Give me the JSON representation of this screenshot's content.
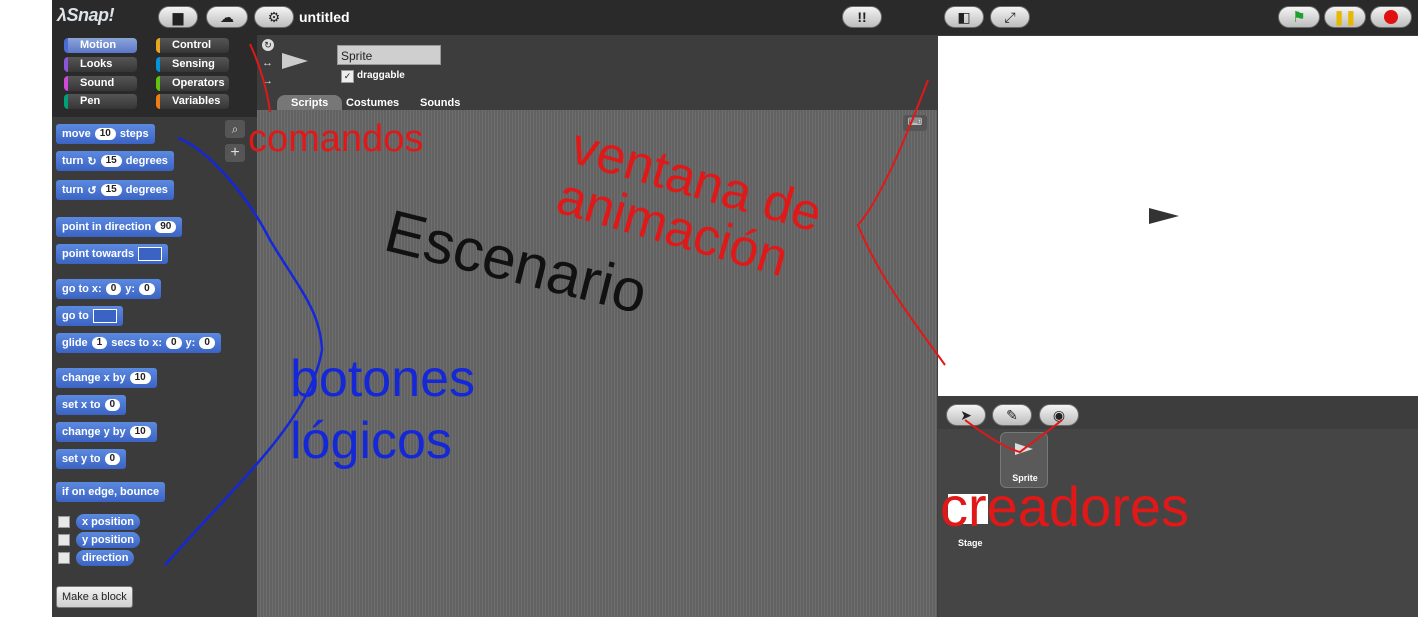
{
  "app": {
    "logo": "λSnap!",
    "project_title": "untitled"
  },
  "topbar": {
    "file_icon": "file-icon",
    "cloud_icon": "cloud-icon",
    "settings_icon": "gear-icon",
    "stage_icon": "stage-size-icon",
    "fullscreen_icon": "fullscreen-icon",
    "green_flag": "green-flag-icon",
    "pause": "pause-icon",
    "stop": "stop-icon",
    "colors": {
      "flag": "#1fa02b",
      "pause": "#e6b800",
      "stop": "#e01010"
    }
  },
  "categories": [
    {
      "label": "Motion",
      "color": "#4a6cd4",
      "selected": true
    },
    {
      "label": "Control",
      "color": "#e6a822"
    },
    {
      "label": "Looks",
      "color": "#8a55d7"
    },
    {
      "label": "Sensing",
      "color": "#0494dc"
    },
    {
      "label": "Sound",
      "color": "#cf4ad9"
    },
    {
      "label": "Operators",
      "color": "#62c213"
    },
    {
      "label": "Pen",
      "color": "#00a178"
    },
    {
      "label": "Variables",
      "color": "#ee7d16"
    }
  ],
  "sprite": {
    "name": "Sprite",
    "draggable_label": "draggable",
    "draggable": true
  },
  "tabs": [
    "Scripts",
    "Costumes",
    "Sounds"
  ],
  "blocks": {
    "move": [
      "move",
      "10",
      "steps"
    ],
    "turn_cw": [
      "turn",
      "15",
      "degrees"
    ],
    "turn_ccw": [
      "turn",
      "15",
      "degrees"
    ],
    "point_dir": [
      "point in direction",
      "90"
    ],
    "point_towards": "point towards",
    "go_to_xy": [
      "go to x:",
      "0",
      "y:",
      "0"
    ],
    "go_to": "go to",
    "glide": [
      "glide",
      "1",
      "secs to x:",
      "0",
      "y:",
      "0"
    ],
    "change_x": [
      "change x by",
      "10"
    ],
    "set_x": [
      "set x to",
      "0"
    ],
    "change_y": [
      "change y by",
      "10"
    ],
    "set_y": [
      "set y to",
      "0"
    ],
    "bounce": "if on edge, bounce",
    "x_position": "x position",
    "y_position": "y position",
    "direction": "direction",
    "make_block": "Make a block"
  },
  "corral": {
    "sprite_label": "Sprite",
    "stage_label": "Stage"
  },
  "annotations": {
    "comandos": "comandos",
    "escenario": "Escenario",
    "ventana": "ventana de animación",
    "botones": "botones lógicos",
    "creadores": "creadores"
  }
}
